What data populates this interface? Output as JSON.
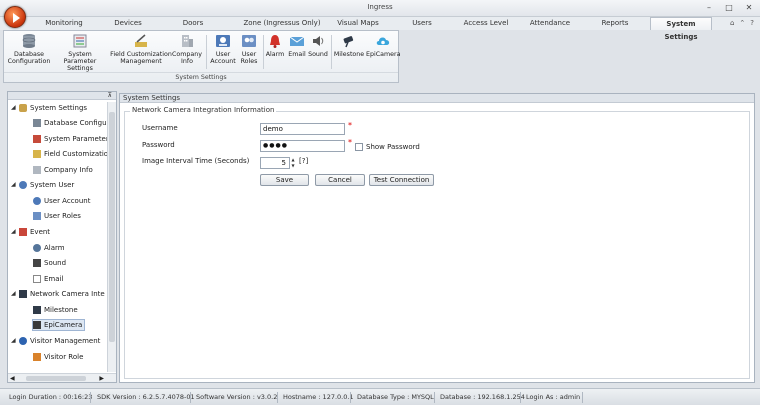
{
  "window": {
    "title": "Ingress",
    "controls": [
      "–",
      "□",
      "✕"
    ]
  },
  "tabs": [
    {
      "label": "Monitoring",
      "active": false
    },
    {
      "label": "Devices",
      "active": false
    },
    {
      "label": "Doors",
      "active": false
    },
    {
      "label": "Zone (Ingressus Only)",
      "active": false
    },
    {
      "label": "Visual Maps",
      "active": false
    },
    {
      "label": "Users",
      "active": false
    },
    {
      "label": "Access Level",
      "active": false
    },
    {
      "label": "Attendance",
      "active": false
    },
    {
      "label": "Reports",
      "active": false
    },
    {
      "label": "System Settings",
      "active": true
    }
  ],
  "tab_icons": [
    "home-icon",
    "minimize-ribbon-icon",
    "help-icon"
  ],
  "ribbon": {
    "group_label": "System Settings",
    "items": [
      {
        "line1": "Database",
        "line2": "Configuration",
        "icon": "database-icon"
      },
      {
        "line1": "System Parameter",
        "line2": "Settings",
        "icon": "parameter-settings-icon"
      },
      {
        "line1": "Field Customization",
        "line2": "Management",
        "icon": "field-customization-icon"
      },
      {
        "line1": "Company",
        "line2": "Info",
        "icon": "company-building-icon"
      },
      {
        "line1": "User",
        "line2": "Account",
        "icon": "user-account-icon"
      },
      {
        "line1": "User",
        "line2": "Roles",
        "icon": "user-roles-icon"
      },
      {
        "line1": "Alarm",
        "line2": "",
        "icon": "alarm-icon"
      },
      {
        "line1": "Email",
        "line2": "",
        "icon": "email-icon"
      },
      {
        "line1": "Sound",
        "line2": "",
        "icon": "sound-icon"
      },
      {
        "line1": "Milestone",
        "line2": "",
        "icon": "milestone-camera-icon"
      },
      {
        "line1": "EpiCamera",
        "line2": "",
        "icon": "epicamera-icon"
      }
    ]
  },
  "tree": {
    "nodes": [
      {
        "label": "System Settings",
        "level": 0,
        "expander": "◢"
      },
      {
        "label": "Database Configurat",
        "level": 1
      },
      {
        "label": "System Parameter Se",
        "level": 1
      },
      {
        "label": "Field Customization M",
        "level": 1
      },
      {
        "label": "Company Info",
        "level": 1
      },
      {
        "label": "System User",
        "level": 0,
        "expander": "◢"
      },
      {
        "label": "User Account",
        "level": 1
      },
      {
        "label": "User Roles",
        "level": 1
      },
      {
        "label": "Event",
        "level": 0,
        "expander": "◢"
      },
      {
        "label": "Alarm",
        "level": 1
      },
      {
        "label": "Sound",
        "level": 1
      },
      {
        "label": "Email",
        "level": 1
      },
      {
        "label": "Network Camera Inte",
        "level": 0,
        "expander": "◢"
      },
      {
        "label": "Milestone",
        "level": 1
      },
      {
        "label": "EpiCamera",
        "level": 1,
        "selected": true
      },
      {
        "label": "Visitor Management",
        "level": 0,
        "expander": "◢"
      },
      {
        "label": "Visitor Role",
        "level": 1
      }
    ],
    "pin_glyph": "⊼",
    "hscroll_arrows": [
      "◀",
      "▶"
    ]
  },
  "main": {
    "header": "System Settings",
    "group_title": "Network Camera Integration Information",
    "username_label": "Username",
    "username_value": "demo",
    "password_label": "Password",
    "password_value": "●●●●",
    "show_password_label": "Show Password",
    "interval_label": "Image Interval Time (Seconds)",
    "interval_value": "5",
    "interval_hint": "[?]",
    "required_mark": "*",
    "buttons": {
      "save": "Save",
      "cancel": "Cancel",
      "test": "Test Connection"
    }
  },
  "status": [
    "Login Duration : 00:16:23",
    "SDK Version : 6.2.5.7.4078-01",
    "Software Version : v3.0.2",
    "Hostname : 127.0.0.1",
    "Database Type : MYSQL",
    "Database : 192.168.1.254",
    "Login As : admin"
  ]
}
